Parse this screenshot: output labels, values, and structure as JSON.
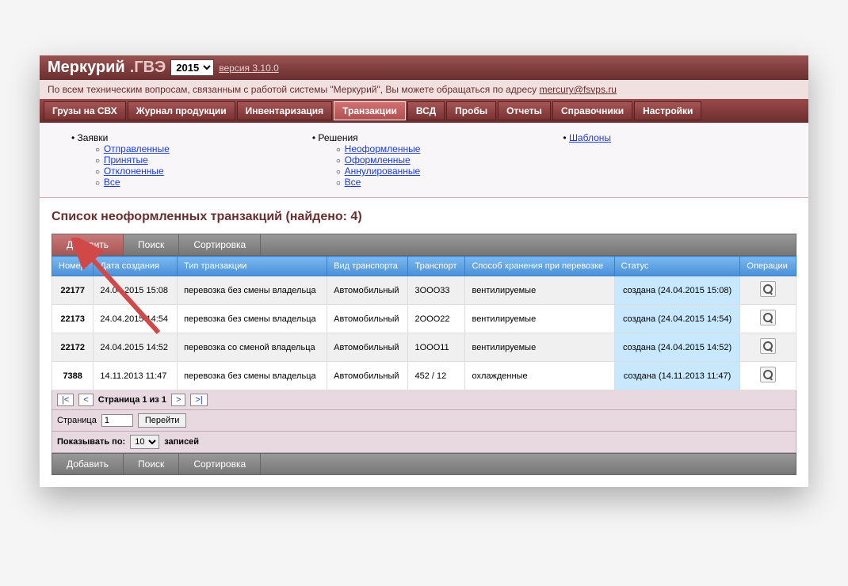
{
  "header": {
    "title_main": "Меркурий",
    "title_sub": ".ГВЭ",
    "year": "2015",
    "version": "версия 3.10.0"
  },
  "support": {
    "text": "По всем техническим вопросам, связанным с работой системы \"Меркурий\", Вы можете обращаться по адресу ",
    "email": "mercury@fsvps.ru"
  },
  "tabs": [
    "Грузы на СВХ",
    "Журнал продукции",
    "Инвентаризация",
    "Транзакции",
    "ВСД",
    "Пробы",
    "Отчеты",
    "Справочники",
    "Настройки"
  ],
  "active_tab": 3,
  "subnav": {
    "col1": {
      "title": "Заявки",
      "items": [
        "Отправленные",
        "Принятые",
        "Отклоненные",
        "Все"
      ]
    },
    "col2": {
      "title": "Решения",
      "items": [
        "Неоформленные",
        "Оформленные",
        "Аннулированные",
        "Все"
      ]
    },
    "col3": {
      "link": "Шаблоны"
    }
  },
  "page_title": "Список неоформленных транзакций (найдено: 4)",
  "toolbar": {
    "add": "Добавить",
    "search": "Поиск",
    "sort": "Сортировка"
  },
  "table": {
    "headers": [
      "Номер",
      "Дата создания",
      "Тип транзакции",
      "Вид транспорта",
      "Транспорт",
      "Способ хранения при перевозке",
      "Статус",
      "Операции"
    ],
    "rows": [
      {
        "num": "22177",
        "date": "24.04.2015 15:08",
        "type": "перевозка без смены владельца",
        "transport_kind": "Автомобильный",
        "transport": "3ООО33",
        "storage": "вентилируемые",
        "status": "создана (24.04.2015 15:08)"
      },
      {
        "num": "22173",
        "date": "24.04.2015 14:54",
        "type": "перевозка без смены владельца",
        "transport_kind": "Автомобильный",
        "transport": "2ООО22",
        "storage": "вентилируемые",
        "status": "создана (24.04.2015 14:54)"
      },
      {
        "num": "22172",
        "date": "24.04.2015 14:52",
        "type": "перевозка со сменой владельца",
        "transport_kind": "Автомобильный",
        "transport": "1ООО11",
        "storage": "вентилируемые",
        "status": "создана (24.04.2015 14:52)"
      },
      {
        "num": "7388",
        "date": "14.11.2013 11:47",
        "type": "перевозка без смены владельца",
        "transport_kind": "Автомобильный",
        "transport": "452 / 12",
        "storage": "охлажденные",
        "status": "создана (14.11.2013 11:47)"
      }
    ]
  },
  "pager": {
    "first": "|<",
    "prev": "<",
    "text": "Страница 1 из 1",
    "next": ">",
    "last": ">|",
    "page_label": "Страница",
    "page_value": "1",
    "go": "Перейти",
    "perpage_label": "Показывать по:",
    "perpage_value": "10",
    "perpage_suffix": "записей"
  }
}
